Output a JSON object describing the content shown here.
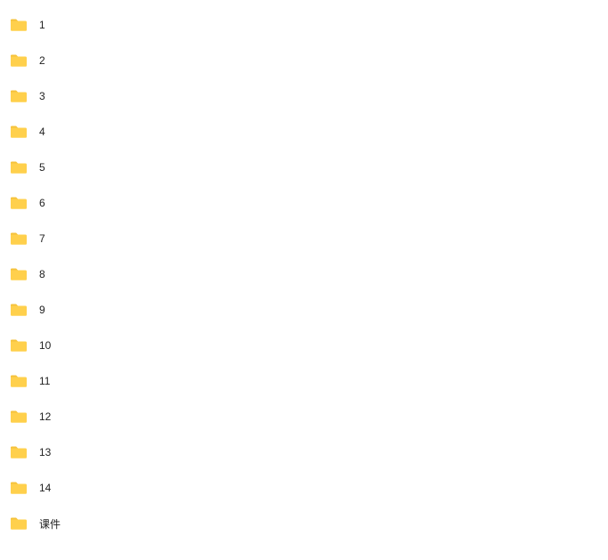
{
  "folders": [
    {
      "name": "1"
    },
    {
      "name": "2"
    },
    {
      "name": "3"
    },
    {
      "name": "4"
    },
    {
      "name": "5"
    },
    {
      "name": "6"
    },
    {
      "name": "7"
    },
    {
      "name": "8"
    },
    {
      "name": "9"
    },
    {
      "name": "10"
    },
    {
      "name": "11"
    },
    {
      "name": "12"
    },
    {
      "name": "13"
    },
    {
      "name": "14"
    },
    {
      "name": "课件"
    }
  ],
  "iconName": "folder-icon"
}
